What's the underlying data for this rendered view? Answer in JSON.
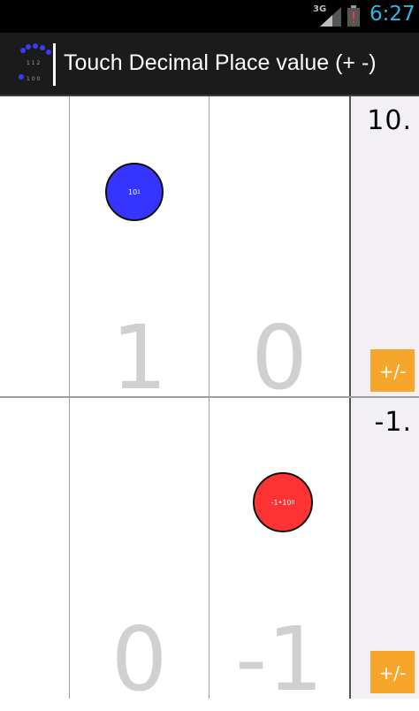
{
  "status_bar": {
    "network": "3G",
    "time": "6:27",
    "icons": [
      "signal-icon",
      "battery-alert-icon"
    ],
    "time_color": "#33b5e5"
  },
  "action_bar": {
    "title": "Touch Decimal Place value (+ -)",
    "app_icon": "app-logo-icon"
  },
  "panels": [
    {
      "digits": [
        "1",
        "0"
      ],
      "value": "10.",
      "sign_button": "+/-",
      "token": {
        "base": "10",
        "exponent": "1",
        "color": "#3535ff"
      }
    },
    {
      "digits": [
        "0",
        "-1"
      ],
      "value": "-1.",
      "sign_button": "+/-",
      "token": {
        "base": "-1•10",
        "exponent": "0",
        "color": "#ff3333"
      }
    }
  ],
  "colors": {
    "sign_button": "#f6a62b",
    "display_bg": "#f2eff5",
    "digit": "#d0d0d0"
  }
}
